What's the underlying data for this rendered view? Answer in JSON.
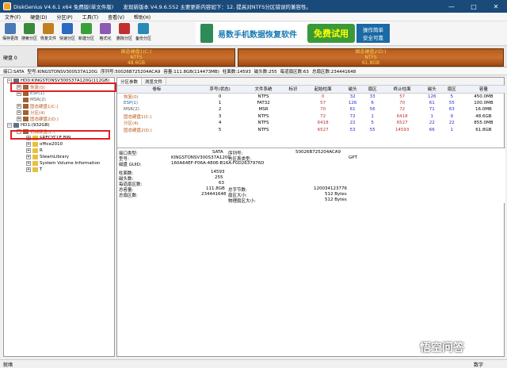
{
  "window": {
    "title": "DiskGenius V4.6.1 x64 免费版(单文件版)",
    "notice": "发现新版本 V4.9.6.552 主要更新内容如下：12. 提高对NTFS分区错误的兼容性。",
    "min": "—",
    "max": "□",
    "close": "✕"
  },
  "menu": [
    "文件(F)",
    "硬盘(D)",
    "分区(P)",
    "工具(T)",
    "查看(V)",
    "帮助(H)"
  ],
  "toolbar": [
    {
      "label": "保存更改",
      "icon": "save-icon",
      "color": "#4a7ab5"
    },
    {
      "label": "搜索分区",
      "icon": "search-icon",
      "color": "#3a8a3a"
    },
    {
      "label": "恢复文件",
      "icon": "recover-icon",
      "color": "#c08020"
    },
    {
      "label": "快速分区",
      "icon": "quick-partition-icon",
      "color": "#2a6ac0"
    },
    {
      "label": "新建分区",
      "icon": "new-partition-icon",
      "color": "#3aa03a"
    },
    {
      "label": "格式化",
      "icon": "format-icon",
      "color": "#8a5ab5"
    },
    {
      "label": "删除分区",
      "icon": "delete-icon",
      "color": "#c03030"
    },
    {
      "label": "备份分区",
      "icon": "backup-icon",
      "color": "#2a8ab5"
    }
  ],
  "banner": {
    "text": "易数手机数据恢复软件",
    "logo": "免费试用",
    "side1": "操作简单",
    "side2": "安全可靠"
  },
  "diskbar": {
    "label1": "硬盘 0",
    "partitions": [
      {
        "name": "固态硬盘1(C:)",
        "fs": "NTFS",
        "size": "48.6GB"
      },
      {
        "name": "固态硬盘2(D:)",
        "fs": "NTFS",
        "size": "61.8GB"
      }
    ]
  },
  "infobar": {
    "iface": "接口:SATA",
    "model": "型号:KINGSTONSV300S37A120G",
    "serial": "序列号:50026B725204ACA9",
    "capacity": "容量:111.8GB(114473MB)",
    "cyl": "柱面数:14593",
    "heads": "磁头数:255",
    "spt": "每道扇区数:63",
    "total": "总扇区数:234441648"
  },
  "tree": [
    {
      "text": "HD0:KINGSTONSV300S37A120G(112GB)",
      "indent": 0,
      "tw": "−"
    },
    {
      "text": "恢复(0)",
      "indent": 1,
      "tw": "+"
    },
    {
      "text": "ESP(1)",
      "indent": 1,
      "tw": "+"
    },
    {
      "text": "MSR(2)",
      "indent": 1,
      "tw": ""
    },
    {
      "text": "固态硬盘1(C:)",
      "indent": 1,
      "tw": "+"
    },
    {
      "text": "分区(4)",
      "indent": 1,
      "tw": "+"
    },
    {
      "text": "固态硬盘2(D:)",
      "indent": 1,
      "tw": "+"
    },
    {
      "text": "HD1:(932GB)",
      "indent": 0,
      "tw": "−"
    },
    {
      "text": "机械硬盘(E:)",
      "indent": 1,
      "tw": "−"
    },
    {
      "text": "$RECYCLE.BIN",
      "indent": 2,
      "tw": "+"
    },
    {
      "text": "office2010",
      "indent": 2,
      "tw": "+"
    },
    {
      "text": "R",
      "indent": 2,
      "tw": "+"
    },
    {
      "text": "SteamLibrary",
      "indent": 2,
      "tw": "+"
    },
    {
      "text": "System Volume Information",
      "indent": 2,
      "tw": "+"
    },
    {
      "text": "T",
      "indent": 2,
      "tw": "+"
    }
  ],
  "tabs": [
    "分区参数",
    "浏览文件"
  ],
  "table": {
    "headers": [
      "卷标",
      "序号(状态)",
      "文件系统",
      "标识",
      "起始柱面",
      "磁头",
      "扇区",
      "终止柱面",
      "磁头",
      "扇区",
      "容量"
    ],
    "rows": [
      [
        "恢复(0)",
        "0",
        "NTFS",
        "",
        "0",
        "32",
        "33",
        "57",
        "126",
        "5",
        "450.0MB"
      ],
      [
        "ESP(1)",
        "1",
        "FAT32",
        "",
        "57",
        "126",
        "6",
        "70",
        "61",
        "55",
        "100.0MB"
      ],
      [
        "MSR(2)",
        "2",
        "MSR",
        "",
        "70",
        "61",
        "56",
        "72",
        "71",
        "63",
        "16.0MB"
      ],
      [
        "固态硬盘1(C:)",
        "3",
        "NTFS",
        "",
        "72",
        "72",
        "1",
        "6418",
        "1",
        "9",
        "48.6GB"
      ],
      [
        "分区(4)",
        "4",
        "NTFS",
        "",
        "6418",
        "22",
        "5",
        "6527",
        "22",
        "22",
        "855.0MB"
      ],
      [
        "固态硬盘2(D:)",
        "5",
        "NTFS",
        "",
        "6527",
        "53",
        "55",
        "14593",
        "66",
        "1",
        "61.8GB"
      ]
    ]
  },
  "details": {
    "iface_l": "接口类型:",
    "iface_v": "SATA",
    "serial_l": "序列号:",
    "serial_v": "50026B725204ACA9",
    "model_l": "型号:",
    "model_v": "KINGSTONSV300S37A120G",
    "ptype_l": "分区表类型:",
    "ptype_v": "GPT",
    "guid_l": "磁盘 GUID:",
    "guid_v": "160A64EF-F06A-4806-B16A-F0D2637976D",
    "cyl_l": "柱面数:",
    "cyl_v": "14593",
    "heads_l": "磁头数:",
    "heads_v": "255",
    "spt_l": "每道扇区数:",
    "spt_v": "63",
    "cap_l": "总容量:",
    "cap_v": "111.8GB",
    "bytes_l": "总字节数:",
    "bytes_v": "120034123776",
    "tsec_l": "总扇区数:",
    "tsec_v": "234441648",
    "sec_l": "扇区大小:",
    "sec_v": "512 Bytes",
    "psec_l": "物理扇区大小:",
    "psec_v": "512 Bytes"
  },
  "status": {
    "text": "就绪",
    "num": "数字"
  },
  "watermark": "悟空问答"
}
